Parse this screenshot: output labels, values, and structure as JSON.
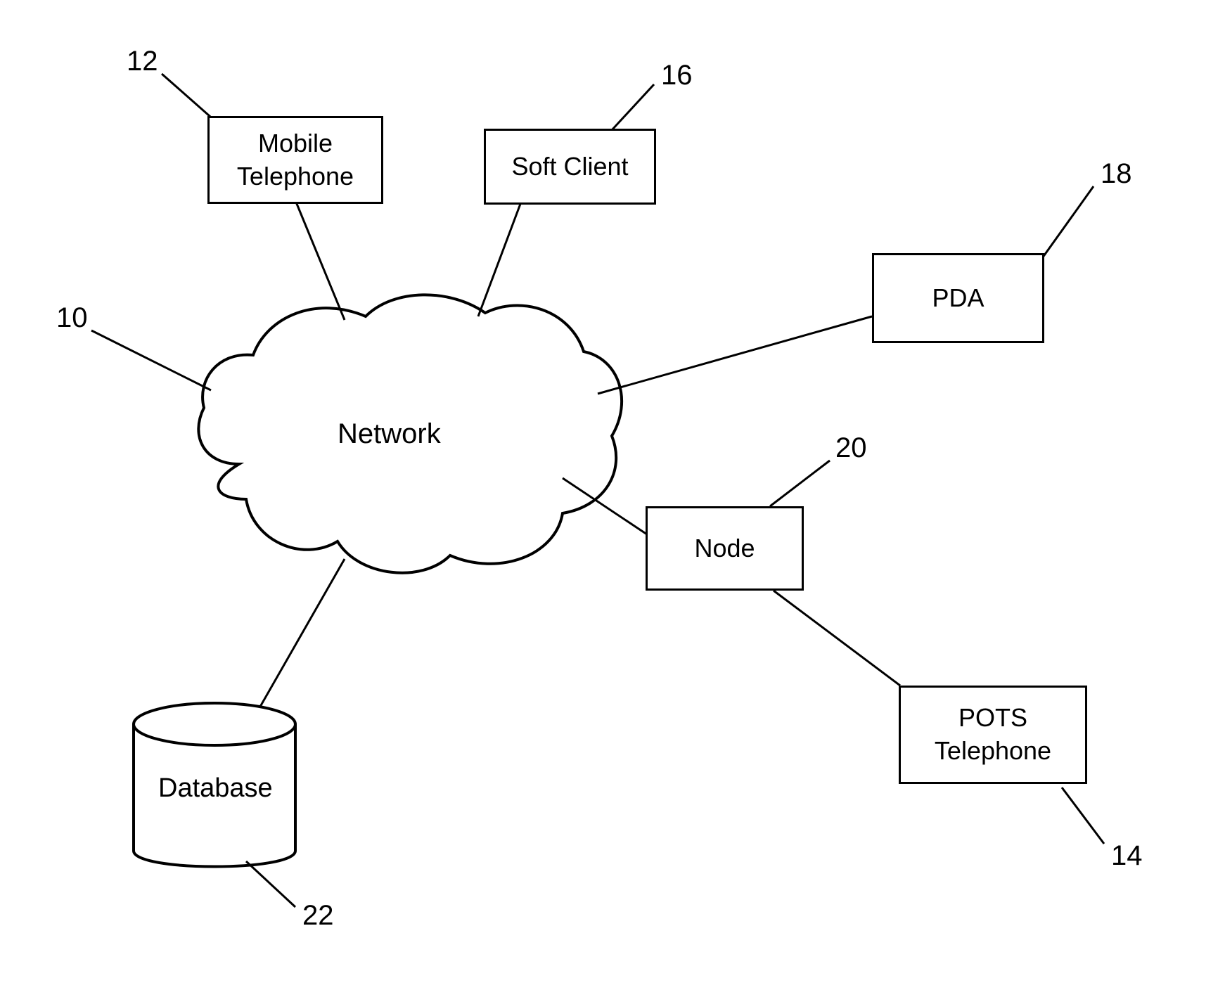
{
  "diagram": {
    "network_label": "Network",
    "boxes": {
      "mobile_telephone": "Mobile\nTelephone",
      "soft_client": "Soft Client",
      "pda": "PDA",
      "node": "Node",
      "pots_telephone": "POTS\nTelephone",
      "database": "Database"
    },
    "refs": {
      "r10": "10",
      "r12": "12",
      "r14": "14",
      "r16": "16",
      "r18": "18",
      "r20": "20",
      "r22": "22"
    }
  }
}
